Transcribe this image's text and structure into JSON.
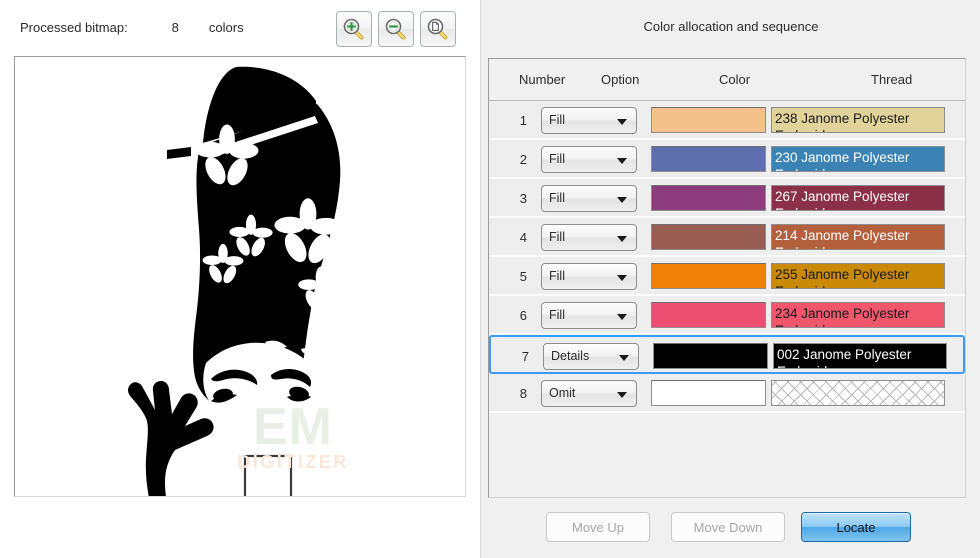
{
  "left": {
    "bitmap_label": "Processed bitmap:",
    "color_count": "8",
    "colors_word": "colors",
    "zoom_tools": [
      {
        "name": "zoom-in-icon",
        "title": "Zoom In"
      },
      {
        "name": "zoom-out-icon",
        "title": "Zoom Out"
      },
      {
        "name": "zoom-fit-icon",
        "title": "Fit To Page"
      }
    ],
    "watermark": {
      "line1": "EM",
      "line2": "DIGITIZER"
    }
  },
  "right": {
    "panel_title": "Color allocation and sequence",
    "columns": {
      "number": "Number",
      "option": "Option",
      "color": "Color",
      "thread": "Thread"
    },
    "rows": [
      {
        "number": "1",
        "option": "Fill",
        "color": "#f5c18a",
        "thread_text": "238 Janome Polyester",
        "thread_text2": "Embroidery",
        "thread_bg": "#e2d39a",
        "thread_fg": "#1a1a1a",
        "selected": false,
        "omit": false
      },
      {
        "number": "2",
        "option": "Fill",
        "color": "#5f6fad",
        "thread_text": "230 Janome Polyester",
        "thread_text2": "Embroidery",
        "thread_bg": "#3c83b5",
        "thread_fg": "#ffffff",
        "selected": false,
        "omit": false
      },
      {
        "number": "3",
        "option": "Fill",
        "color": "#8d3c7e",
        "thread_text": "267 Janome Polyester",
        "thread_text2": "Embroidery",
        "thread_bg": "#8c2f49",
        "thread_fg": "#ffffff",
        "selected": false,
        "omit": false
      },
      {
        "number": "4",
        "option": "Fill",
        "color": "#9a5d54",
        "thread_text": "214 Janome Polyester",
        "thread_text2": "Embroidery",
        "thread_bg": "#b5603c",
        "thread_fg": "#ffffff",
        "selected": false,
        "omit": false
      },
      {
        "number": "5",
        "option": "Fill",
        "color": "#ef8206",
        "thread_text": "255 Janome Polyester",
        "thread_text2": "Embroidery",
        "thread_bg": "#ca8a07",
        "thread_fg": "#1a1a1a",
        "selected": false,
        "omit": false
      },
      {
        "number": "6",
        "option": "Fill",
        "color": "#ed4f73",
        "thread_text": "234 Janome Polyester",
        "thread_text2": "Embroidery",
        "thread_bg": "#f0566c",
        "thread_fg": "#1a1a1a",
        "selected": false,
        "omit": false
      },
      {
        "number": "7",
        "option": "Details",
        "color": "#000000",
        "thread_text": "002 Janome Polyester",
        "thread_text2": "Embroidery",
        "thread_bg": "#000000",
        "thread_fg": "#ffffff",
        "selected": true,
        "omit": false
      },
      {
        "number": "8",
        "option": "Omit",
        "color": "#ffffff",
        "thread_text": "",
        "thread_text2": "",
        "thread_bg": "#ffffff",
        "thread_fg": "#1a1a1a",
        "selected": false,
        "omit": true
      }
    ],
    "buttons": {
      "move_up": "Move Up",
      "move_down": "Move Down",
      "locate": "Locate"
    }
  },
  "colors": {
    "selection_blue": "#3a9bf0",
    "panel_bg": "#f0f0f0",
    "row_bg": "#eeeeee"
  }
}
